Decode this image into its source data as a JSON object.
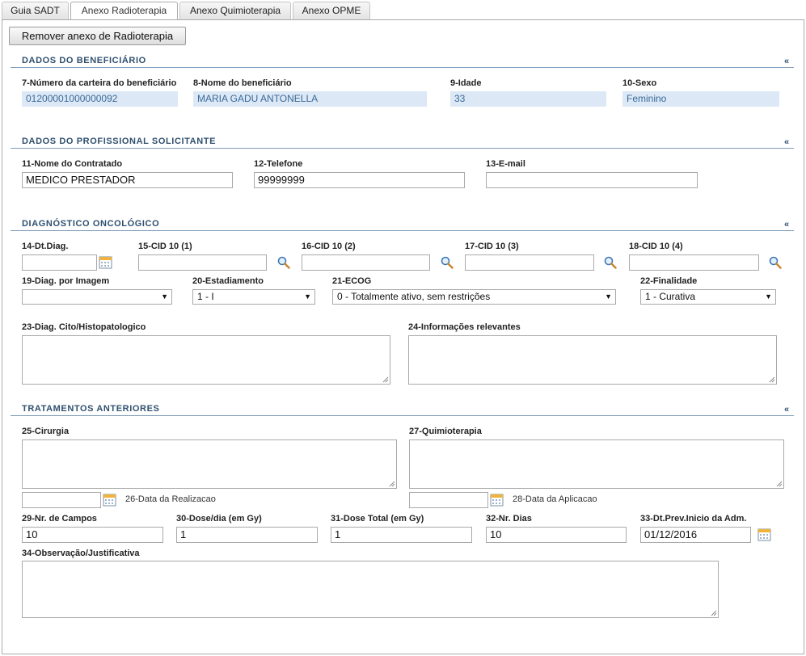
{
  "tabs": [
    {
      "label": "Guia SADT"
    },
    {
      "label": "Anexo Radioterapia"
    },
    {
      "label": "Anexo Quimioterapia"
    },
    {
      "label": "Anexo OPME"
    }
  ],
  "remove_button": "Remover anexo de Radioterapia",
  "collapse_symbol": "«",
  "beneficiario": {
    "title": "DADOS DO BENEFICIÁRIO",
    "carteira_label": "7-Número da carteira do beneficiário",
    "carteira_value": "01200001000000092",
    "nome_label": "8-Nome do beneficiário",
    "nome_value": "MARIA GADU ANTONELLA",
    "idade_label": "9-Idade",
    "idade_value": "33",
    "sexo_label": "10-Sexo",
    "sexo_value": "Feminino"
  },
  "profissional": {
    "title": "DADOS DO PROFISSIONAL SOLICITANTE",
    "contratado_label": "11-Nome do Contratado",
    "contratado_value": "MEDICO PRESTADOR",
    "telefone_label": "12-Telefone",
    "telefone_value": "99999999",
    "email_label": "13-E-mail",
    "email_value": ""
  },
  "diagnostico": {
    "title": "DIAGNÓSTICO ONCOLÓGICO",
    "dt_diag_label": "14-Dt.Diag.",
    "cid1_label": "15-CID 10 (1)",
    "cid2_label": "16-CID 10 (2)",
    "cid3_label": "17-CID 10 (3)",
    "cid4_label": "18-CID 10 (4)",
    "imagem_label": "19-Diag. por Imagem",
    "imagem_value": "",
    "estadiamento_label": "20-Estadiamento",
    "estadiamento_value": "1 - I",
    "ecog_label": "21-ECOG",
    "ecog_value": "0 - Totalmente ativo, sem restrições",
    "finalidade_label": "22-Finalidade",
    "finalidade_value": "1 - Curativa",
    "cito_label": "23-Diag. Cito/Histopatologico",
    "info_label": "24-Informações relevantes"
  },
  "tratamentos": {
    "title": "TRATAMENTOS ANTERIORES",
    "cirurgia_label": "25-Cirurgia",
    "data_realizacao_label": "26-Data da Realizacao",
    "quimio_label": "27-Quimioterapia",
    "data_aplicacao_label": "28-Data da Aplicacao",
    "campos_label": "29-Nr. de Campos",
    "campos_value": "10",
    "dose_dia_label": "30-Dose/dia (em Gy)",
    "dose_dia_value": "1",
    "dose_total_label": "31-Dose Total (em Gy)",
    "dose_total_value": "1",
    "nr_dias_label": "32-Nr. Dias",
    "nr_dias_value": "10",
    "dt_prev_label": "33-Dt.Prev.Inicio da Adm.",
    "dt_prev_value": "01/12/2016",
    "obs_label": "34-Observação/Justificativa"
  }
}
